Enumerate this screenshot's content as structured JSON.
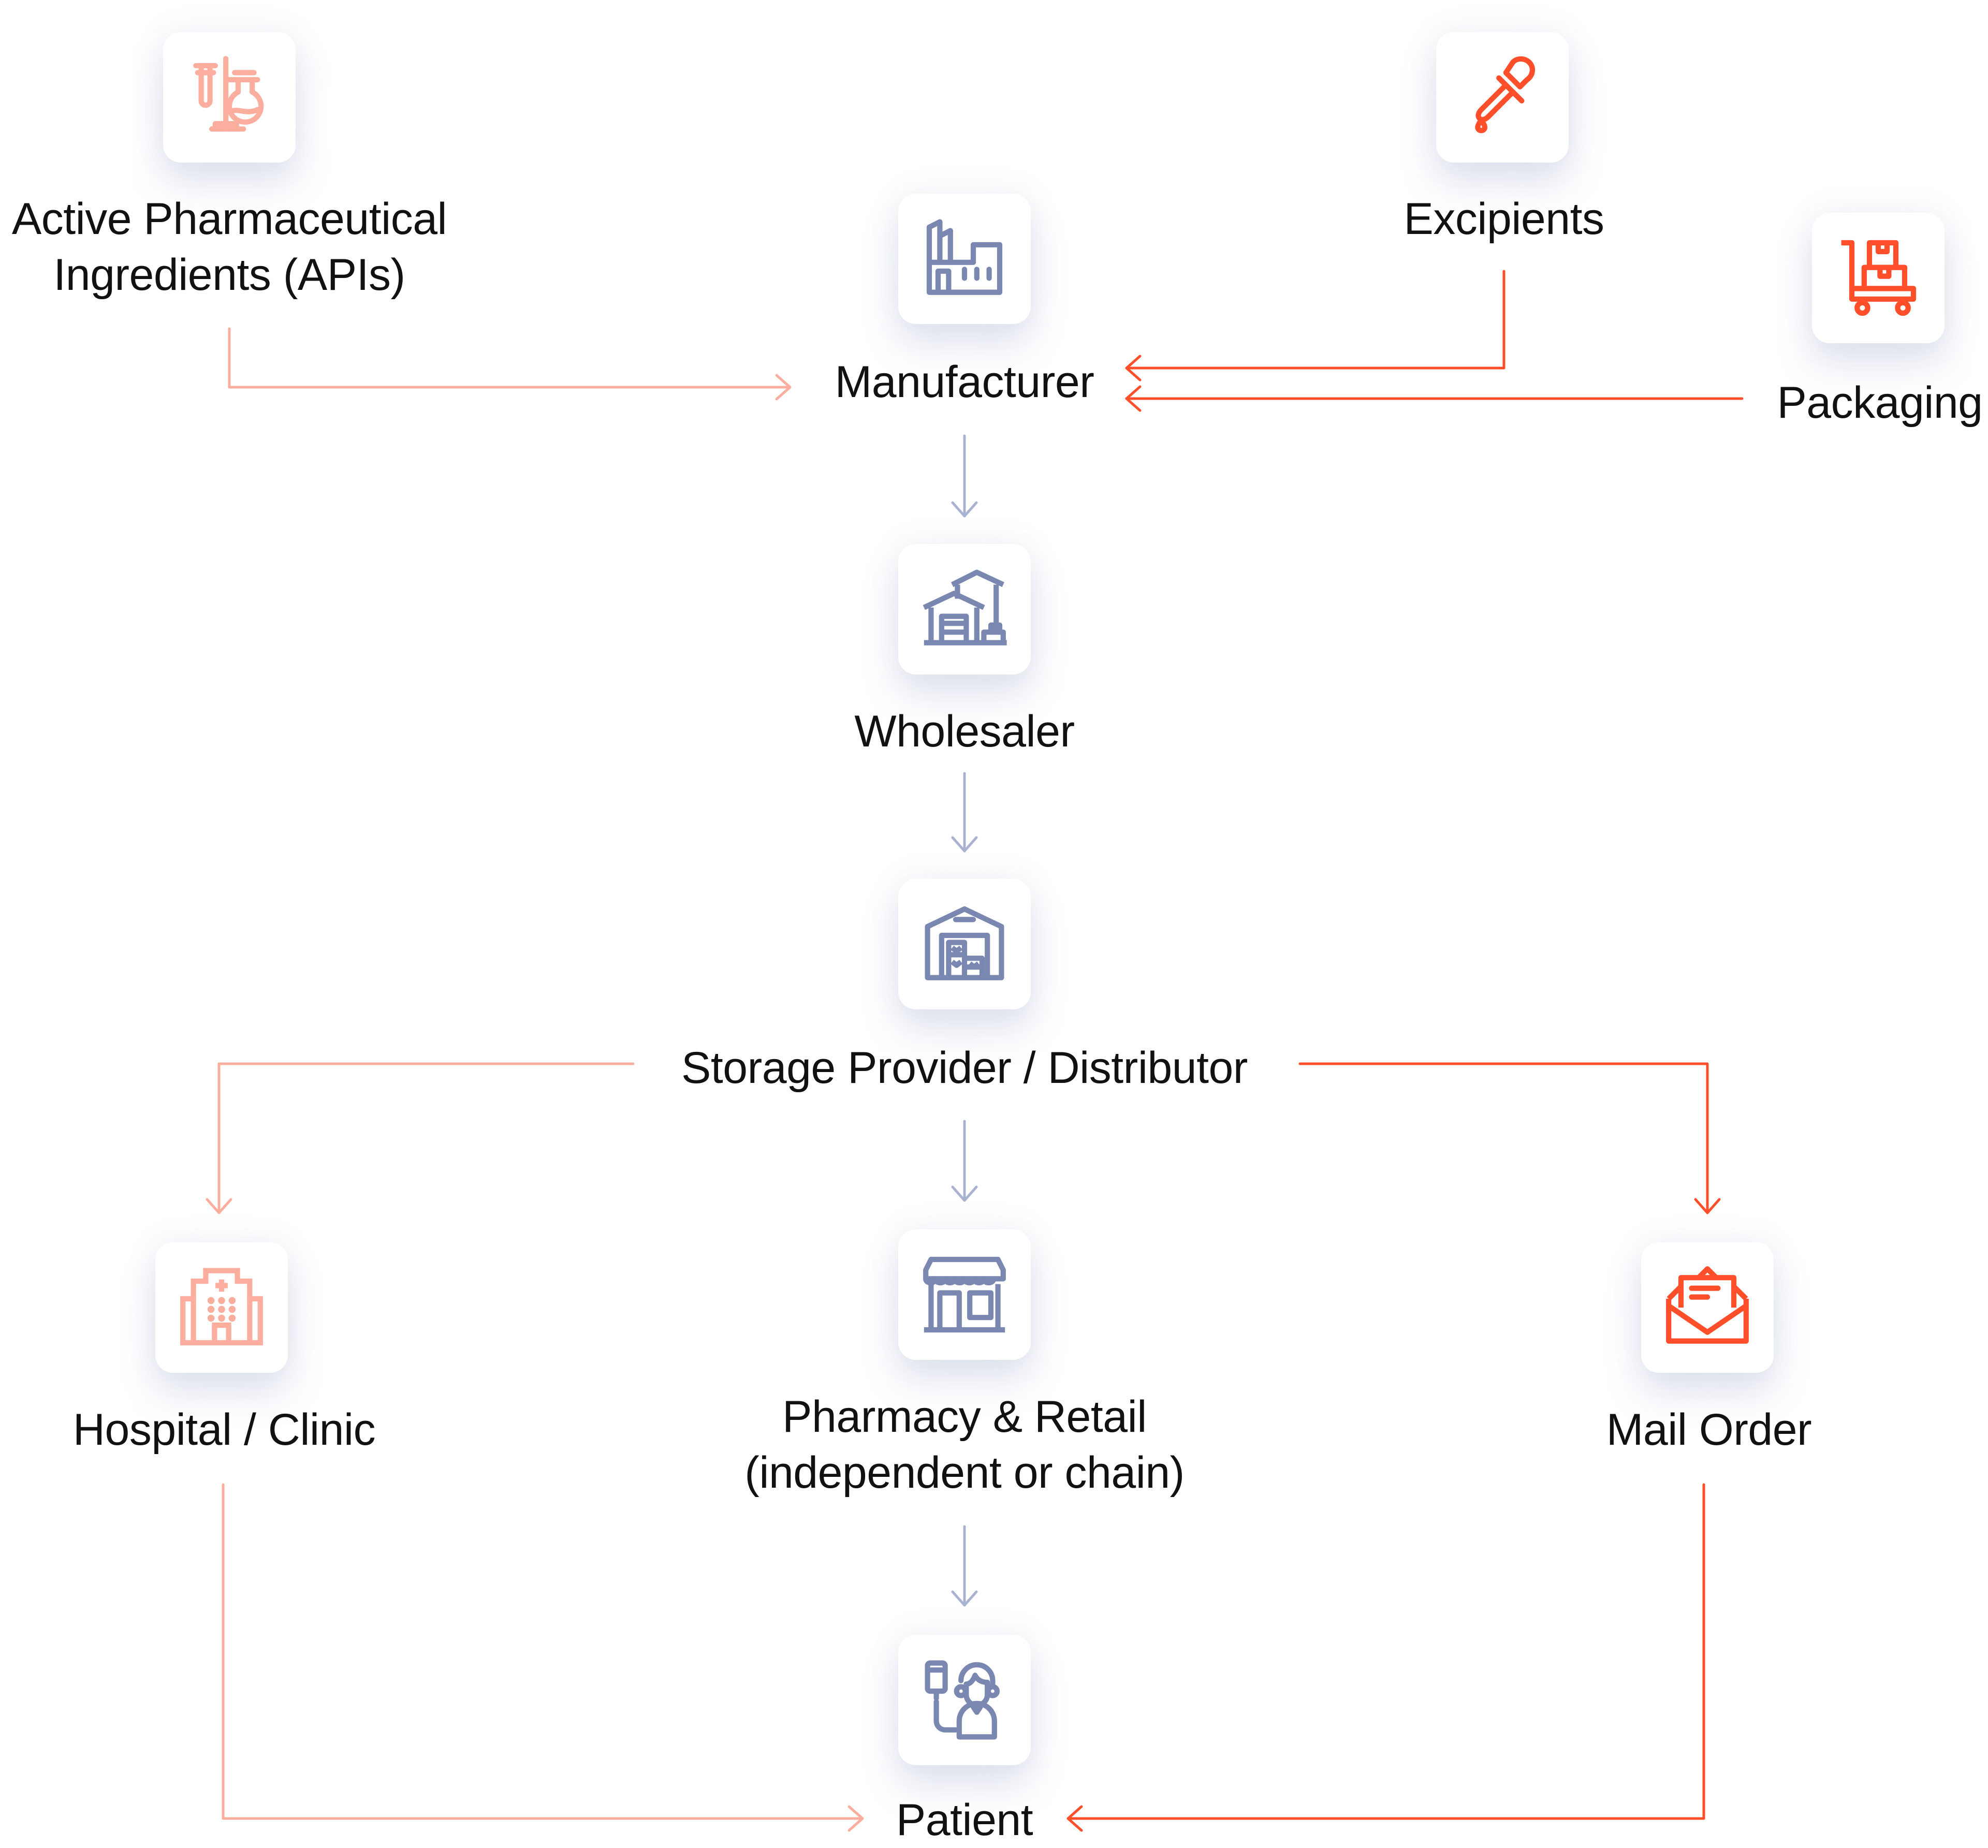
{
  "colors": {
    "light": "#FBAE9E",
    "strong": "#FF4F2A",
    "slate": "#7A87B0",
    "text": "#111111"
  },
  "nodes": {
    "api": {
      "line1": "Active Pharmaceutical",
      "line2": "Ingredients (APIs)",
      "icon": "lab-flask-icon"
    },
    "excipients": {
      "label": "Excipients",
      "icon": "dropper-icon"
    },
    "manufacturer": {
      "label": "Manufacturer",
      "icon": "factory-icon"
    },
    "packaging": {
      "label": "Packaging",
      "icon": "cart-boxes-icon"
    },
    "wholesaler": {
      "label": "Wholesaler",
      "icon": "warehouse-icon"
    },
    "storage": {
      "label": "Storage Provider / Distributor",
      "icon": "storage-building-icon"
    },
    "hospital": {
      "label": "Hospital / Clinic",
      "icon": "hospital-icon"
    },
    "pharmacy": {
      "line1": "Pharmacy & Retail",
      "line2": "(independent or chain)",
      "icon": "storefront-icon"
    },
    "mail": {
      "label": "Mail Order",
      "icon": "envelope-icon"
    },
    "patient": {
      "label": "Patient",
      "icon": "patient-iv-icon"
    }
  },
  "edges": [
    {
      "from": "api",
      "to": "manufacturer",
      "color": "light"
    },
    {
      "from": "excipients",
      "to": "manufacturer",
      "color": "strong"
    },
    {
      "from": "packaging",
      "to": "manufacturer",
      "color": "strong"
    },
    {
      "from": "manufacturer",
      "to": "wholesaler",
      "color": "slate"
    },
    {
      "from": "wholesaler",
      "to": "storage",
      "color": "slate"
    },
    {
      "from": "storage",
      "to": "hospital",
      "color": "light"
    },
    {
      "from": "storage",
      "to": "pharmacy",
      "color": "slate"
    },
    {
      "from": "storage",
      "to": "mail",
      "color": "strong"
    },
    {
      "from": "pharmacy",
      "to": "patient",
      "color": "slate"
    },
    {
      "from": "hospital",
      "to": "patient",
      "color": "light"
    },
    {
      "from": "mail",
      "to": "patient",
      "color": "strong"
    }
  ]
}
